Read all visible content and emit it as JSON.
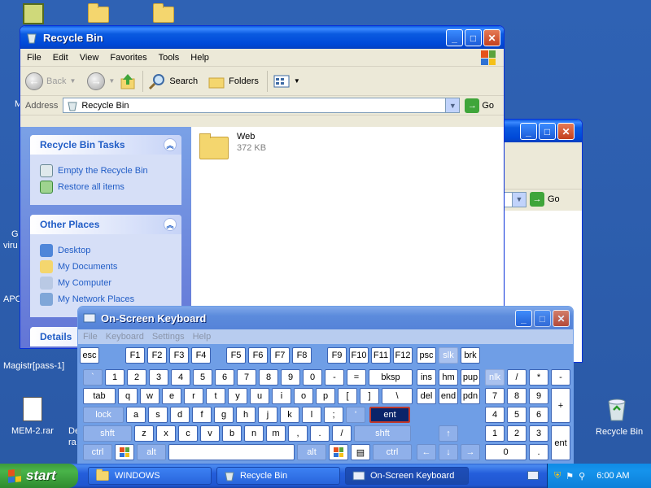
{
  "desktop": {
    "icons_left": [
      {
        "label": "",
        "icon": "calendar-icon"
      },
      {
        "label": "",
        "icon": "folder-icon"
      },
      {
        "label": "",
        "icon": "folder-icon"
      }
    ],
    "partial_labels": [
      "M",
      "M",
      "G",
      "viru",
      "APC"
    ],
    "magistr": "Magistr[pass-1]",
    "mem": "MEM-2.rar",
    "de": "De",
    "ra": "ra",
    "recycle": "Recycle Bin"
  },
  "explorer": {
    "title": "Recycle Bin",
    "menu": [
      "File",
      "Edit",
      "View",
      "Favorites",
      "Tools",
      "Help"
    ],
    "toolbar": {
      "back": "Back",
      "search": "Search",
      "folders": "Folders"
    },
    "address_label": "Address",
    "address_value": "Recycle Bin",
    "go": "Go",
    "tasks_title": "Recycle Bin Tasks",
    "tasks": [
      "Empty the Recycle Bin",
      "Restore all items"
    ],
    "places_title": "Other Places",
    "places": [
      "Desktop",
      "My Documents",
      "My Computer",
      "My Network Places"
    ],
    "details_title": "Details",
    "file": {
      "name": "Web",
      "size": "372 KB"
    }
  },
  "second_window": {
    "go": "Go"
  },
  "osk": {
    "title": "On-Screen Keyboard",
    "menu": [
      "File",
      "Keyboard",
      "Settings",
      "Help"
    ],
    "row0": [
      "esc",
      "F1",
      "F2",
      "F3",
      "F4",
      "F5",
      "F6",
      "F7",
      "F8",
      "F9",
      "F10",
      "F11",
      "F12",
      "psc",
      "slk",
      "brk"
    ],
    "row1": [
      "`",
      "1",
      "2",
      "3",
      "4",
      "5",
      "6",
      "7",
      "8",
      "9",
      "0",
      "-",
      "=",
      "bksp",
      "ins",
      "hm",
      "pup",
      "nlk",
      "/",
      "*",
      "-"
    ],
    "row2": [
      "tab",
      "q",
      "w",
      "e",
      "r",
      "t",
      "y",
      "u",
      "i",
      "o",
      "p",
      "[",
      "]",
      "\\",
      "del",
      "end",
      "pdn",
      "7",
      "8",
      "9",
      "+"
    ],
    "row3": [
      "lock",
      "a",
      "s",
      "d",
      "f",
      "g",
      "h",
      "j",
      "k",
      "l",
      ";",
      "'",
      "ent",
      "4",
      "5",
      "6"
    ],
    "row4": [
      "shft",
      "z",
      "x",
      "c",
      "v",
      "b",
      "n",
      "m",
      ",",
      ".",
      "/",
      "shft",
      "↑",
      "1",
      "2",
      "3",
      "ent"
    ],
    "row5": [
      "ctrl",
      "",
      "alt",
      "",
      "alt",
      "",
      "",
      "ctrl",
      "←",
      "↓",
      "→",
      "0",
      "."
    ]
  },
  "taskbar": {
    "start": "start",
    "tasks": [
      "WINDOWS",
      "Recycle Bin",
      "On-Screen Keyboard"
    ],
    "clock": "6:00 AM"
  }
}
